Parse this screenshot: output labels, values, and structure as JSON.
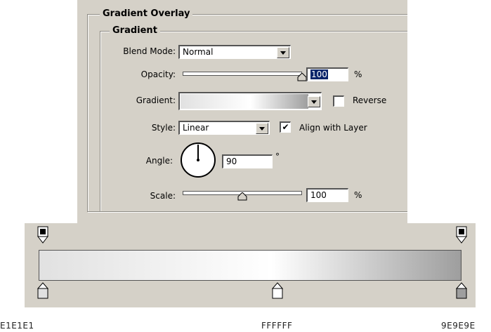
{
  "dialog": {
    "section_title": "Gradient Overlay",
    "group_title": "Gradient",
    "blend_mode": {
      "label": "Blend Mode:",
      "value": "Normal"
    },
    "opacity": {
      "label": "Opacity:",
      "value": "100",
      "unit": "%",
      "level": 1.0
    },
    "gradient": {
      "label": "Gradient:",
      "reverse_label": "Reverse",
      "reverse_checked": false
    },
    "style": {
      "label": "Style:",
      "value": "Linear",
      "align_label": "Align with Layer",
      "align_checked": true
    },
    "angle": {
      "label": "Angle:",
      "value": "90",
      "unit": "°"
    },
    "scale": {
      "label": "Scale:",
      "value": "100",
      "unit": "%",
      "level": 0.5
    }
  },
  "gradient_editor": {
    "colors": {
      "left": "#E1E1E1",
      "mid": "#FFFFFF",
      "right": "#9E9E9E"
    },
    "stop_labels": [
      "E1E1E1",
      "FFFFFF",
      "9E9E9E"
    ]
  }
}
